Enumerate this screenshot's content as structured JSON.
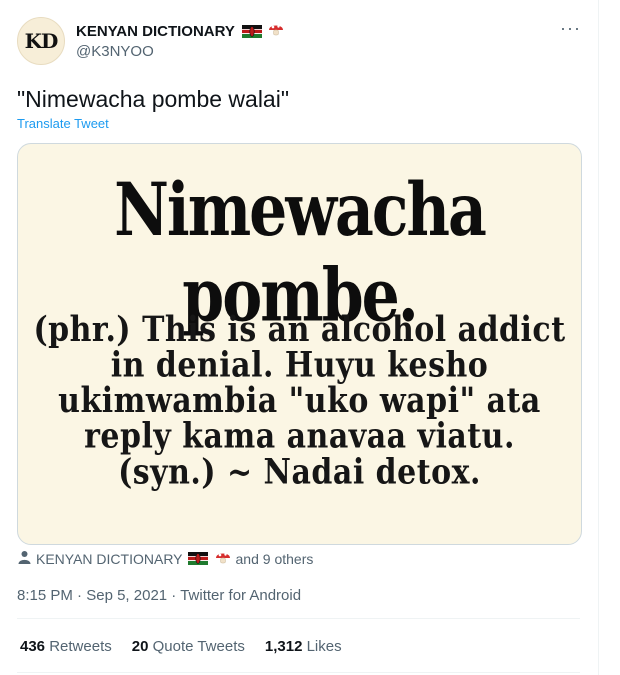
{
  "account": {
    "avatar_text": "KD",
    "name": "KENYAN DICTIONARY",
    "handle": "@K3NYOO"
  },
  "menu": {
    "more_label": "···"
  },
  "tweet": {
    "text": "\"Nimewacha pombe walai\"",
    "translate_label": "Translate Tweet"
  },
  "card": {
    "title": "Nimewacha pombe.",
    "lines": [
      "(phr.) This is an alcohol addict",
      "in denial. Huyu kesho",
      "ukimwambia \"uko wapi\" ata",
      "reply kama anavaa viatu.",
      "(syn.) ~ Nadai detox."
    ]
  },
  "tagged": {
    "name": "KENYAN DICTIONARY",
    "others": "and 9 others"
  },
  "meta": {
    "time": "8:15 PM",
    "sep1": " · ",
    "date": "Sep 5, 2021",
    "sep2": " · ",
    "source": "Twitter for Android"
  },
  "stats": {
    "retweets_count": "436",
    "retweets_label": "Retweets",
    "quotes_count": "20",
    "quotes_label": "Quote Tweets",
    "likes_count": "1,312",
    "likes_label": "Likes"
  },
  "colors": {
    "link": "#1d9bf0",
    "secondary_text": "#536471",
    "card_background": "#fbf6e4"
  },
  "icons": [
    "kenya-flag-icon",
    "mushroom-icon",
    "person-icon",
    "more-icon"
  ]
}
